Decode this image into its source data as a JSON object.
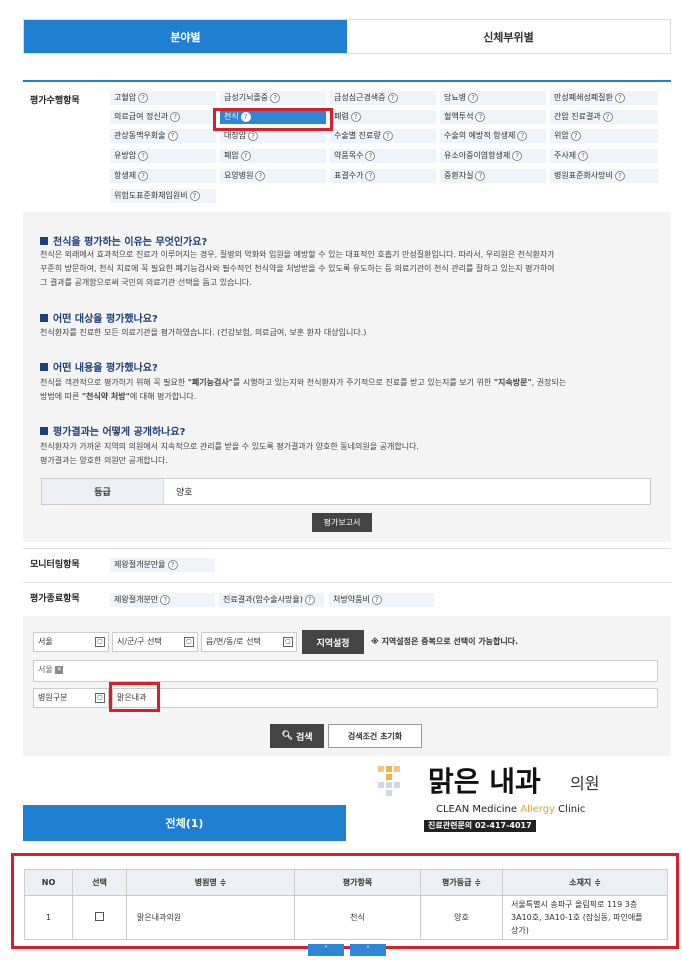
{
  "tabs": {
    "field": "분야별",
    "body_part": "신체부위별"
  },
  "eval_items": {
    "label": "평가수행항목",
    "items": [
      "고혈압",
      "급성기뇌졸중",
      "급성심근경색증",
      "당뇨병",
      "만성폐쇄성폐질환",
      "의료급여 정신과",
      "천식",
      "폐렴",
      "혈액투석",
      "간암 진료결과",
      "관상동맥우회술",
      "대장암",
      "수술별 진료량",
      "수술의 예방적 항생제",
      "위암",
      "유방암",
      "폐암",
      "약품목수",
      "유소아중이염항생제",
      "주사제",
      "항생제",
      "요양병원",
      "표결수가",
      "중환자실",
      "병원표준화사망비",
      "위험도표준화재입원비"
    ]
  },
  "info": {
    "h1": "천식을 평가하는 이유는 무엇인가요?",
    "p1a": "천식은 외래에서 효과적으로 진료가 이루어지는 경우, 질병의 악화와 입원을 예방할 수 있는 대표적인 호흡기 만성질환입니다. 따라서, 우리원은 천식환자가",
    "p1b": "꾸준히 방문하여, 천식 치료에 꼭 필요한 폐기능검사와 필수적인 천식약을 처방받을 수 있도록 유도하는 등 의료기관이 천식 관리를 잘하고 있는지 평가하여",
    "p1c": "그 결과를 공개함으로써 국민의 의료기관 선택을 돕고 있습니다.",
    "h2": "어떤 대상을 평가했나요?",
    "p2": "천식환자를 진료한 모든 의료기관을 평가하였습니다. (건강보험, 의료급여, 보훈 환자 대상입니다.)",
    "h3": "어떤 내용을 평가했나요?",
    "p3a_1": "천식을 객관적으로 평가하기 위해 꼭 필요한 ",
    "p3a_b1": "\"폐기능검사\"",
    "p3a_2": "를 시행하고 있는지와 천식환자가  주기적으로 진료를 받고 있는지를 보기 위한 ",
    "p3a_b2": "\"지속방문\"",
    "p3a_3": ", 권장되는",
    "p3b_1": "방법에 따른 ",
    "p3b_b": "\"천식약 처방\"",
    "p3b_2": "에 대해 평가합니다.",
    "h4": "평가결과는 어떻게 공개하나요?",
    "p4a": "천식환자가 가까운 지역의 의원에서 지속적으로 관리를 받을 수 있도록 평가결과가 양호한  동네의원을 공개합니다.",
    "p4b": "평가결과는 양호한 의원만 공개합니다.",
    "grade_key": "등급",
    "grade_val": "양호",
    "report_btn": "평가보고서"
  },
  "monitoring": {
    "label": "모니터링항목",
    "items": [
      "제왕절개분만율"
    ]
  },
  "ended": {
    "label": "평가종료항목",
    "items": [
      "제왕절개분만",
      "진료결과(암수술사망율)",
      "처방약품비"
    ]
  },
  "search": {
    "region1": "서울",
    "region2": "시/군/구 선택",
    "region3": "읍/면/동/로 선택",
    "region_btn": "지역설정",
    "note": "※ 지역설정은 중복으로 선택이 가능합니다.",
    "selected_tag": "서울",
    "type_label": "병원구분",
    "keyword": "맑은내과",
    "search_btn": "검색",
    "reset_btn": "검색조건 초기화"
  },
  "logo": {
    "name": "맑은 내과",
    "suffix": "의원",
    "en_1": "CLEAN Medicine ",
    "en_2": "Allergy",
    "en_3": " Clinic",
    "phone": "진료관련문의 02-417-4017"
  },
  "results": {
    "tab_label": "전체(1)",
    "headers": [
      "NO",
      "선택",
      "병원명 ≑",
      "평가항목",
      "평가등급 ≑",
      "소재지 ≑"
    ],
    "rows": [
      {
        "no": "1",
        "name": "맑은내과의원",
        "item": "천식",
        "grade": "양호",
        "addr1": "서울특별시 송파구 올림픽로 119 3층",
        "addr2": "3A10호, 3A10-1호 (잠실동, 파인애플",
        "addr3": "상가)"
      }
    ]
  },
  "colors": {
    "accent": "#1f7fd1",
    "highlight": "#d62030",
    "selected": "#2d86d6"
  }
}
